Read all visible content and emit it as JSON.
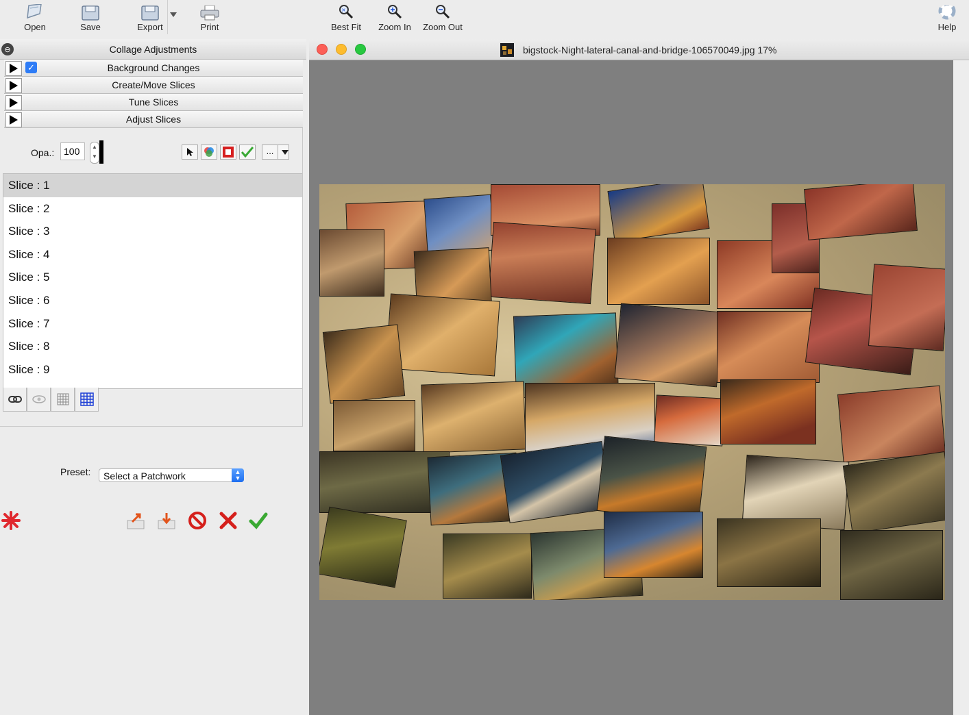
{
  "toolbar": {
    "open": "Open",
    "save": "Save",
    "export": "Export",
    "print": "Print",
    "best_fit": "Best Fit",
    "zoom_in": "Zoom In",
    "zoom_out": "Zoom Out",
    "help": "Help"
  },
  "panel": {
    "title": "Collage Adjustments",
    "sections": [
      "Background Changes",
      "Create/Move Slices",
      "Tune Slices",
      "Adjust Slices"
    ],
    "background_changes_checked": true,
    "opacity_label": "Opa.:",
    "opacity_value": "100",
    "more_label": "...",
    "slices": [
      "Slice : 1",
      "Slice : 2",
      "Slice : 3",
      "Slice : 4",
      "Slice : 5",
      "Slice : 6",
      "Slice : 7",
      "Slice : 8",
      "Slice : 9"
    ],
    "selected_slice": "Slice : 1",
    "preset_label": "Preset:",
    "preset_value": "Select a Patchwork"
  },
  "document": {
    "title": "bigstock-Night-lateral-canal-and-bridge-106570049.jpg 17%",
    "zoom": "17%"
  },
  "colors": {
    "window_bg": "#ececec",
    "canvas_bg": "#7f7f7f",
    "accent": "#2e7cf6",
    "close": "#fc5f57",
    "minimize": "#fdbc2e",
    "zoom": "#28c840"
  }
}
